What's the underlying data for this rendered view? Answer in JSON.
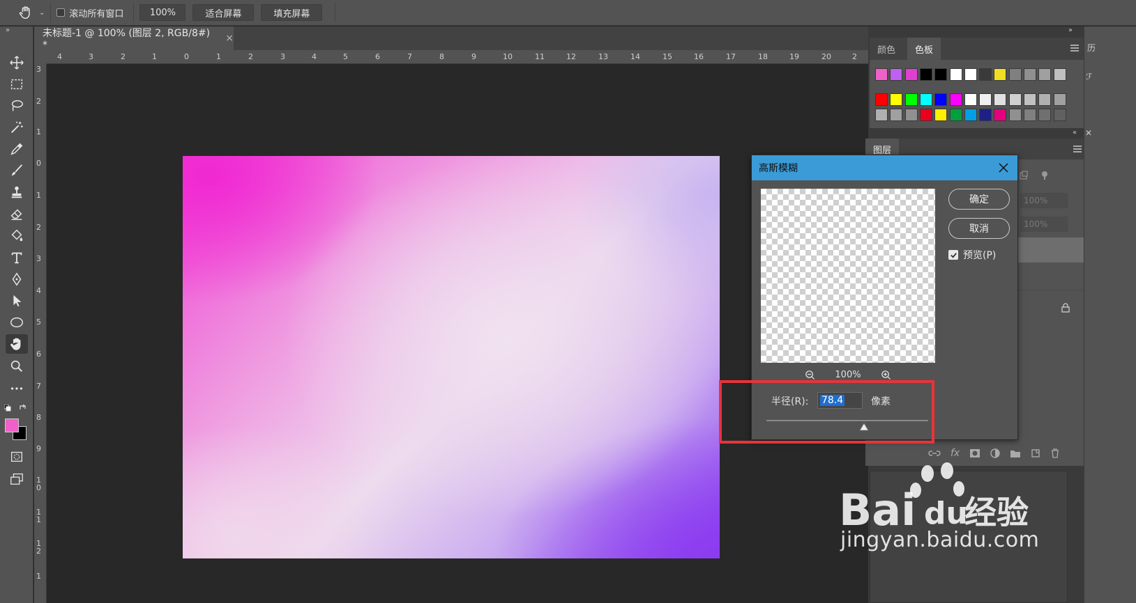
{
  "options_bar": {
    "scroll_all_label": "滚动所有窗口",
    "zoom_value": "100%",
    "fit_screen": "适合屏幕",
    "fill_screen": "填充屏幕"
  },
  "document": {
    "tab_title": "未标题-1 @ 100% (图层 2, RGB/8#) *",
    "close": "×"
  },
  "rulers": {
    "horizontal": [
      "4",
      "3",
      "2",
      "1",
      "0",
      "1",
      "2",
      "3",
      "4",
      "5",
      "6",
      "7",
      "8",
      "9",
      "10",
      "11",
      "12",
      "13",
      "14",
      "15",
      "16",
      "17",
      "18",
      "19",
      "20",
      "2"
    ],
    "vertical": [
      "3",
      "2",
      "1",
      "0",
      "1",
      "2",
      "3",
      "4",
      "5",
      "6",
      "7",
      "8",
      "9",
      "10",
      "11",
      "12",
      "1"
    ]
  },
  "panels": {
    "color_tab": "颜色",
    "swatches_tab": "色板",
    "layers_tab": "图层",
    "opacity": "100%",
    "fill": "100%"
  },
  "swatches": {
    "row1": [
      "#f060c8",
      "#c060f0",
      "#e040d0",
      "#000000",
      "#000000",
      "#ffffff",
      "#ffffff",
      "#3a3a3a",
      "#f0e020",
      "#808080",
      "#909090",
      "#a0a0a0",
      "#c0c0c0"
    ],
    "row2": [
      "#ff0000",
      "#ffff00",
      "#00ff00",
      "#00ffff",
      "#0000ff",
      "#ff00ff",
      "#ffffff",
      "#f0f0f0",
      "#e0e0e0",
      "#d0d0d0",
      "#c0c0c0",
      "#b0b0b0",
      "#a0a0a0"
    ],
    "row3": [
      "#b0b0b0",
      "#a0a0a0",
      "#909090",
      "#e8001e",
      "#fff000",
      "#00a040",
      "#00a0e8",
      "#1e2088",
      "#e4007f",
      "#909090",
      "#808080",
      "#707070",
      "#606060"
    ]
  },
  "dialog": {
    "title": "高斯模糊",
    "ok": "确定",
    "cancel": "取消",
    "preview_label": "预览(P)",
    "zoom": "100%",
    "radius_label": "半径(R):",
    "radius_value": "78.4",
    "unit": "像素",
    "slider_fraction": 0.61
  },
  "watermark": {
    "brand": "Bai",
    "brand2": "du",
    "cn": "经验",
    "url": "jingyan.baidu.com"
  },
  "colors": {
    "foreground": "#f060c8",
    "background": "#000000",
    "dialog_title_bar": "#3a9bd6",
    "highlight": "#e8333a"
  }
}
